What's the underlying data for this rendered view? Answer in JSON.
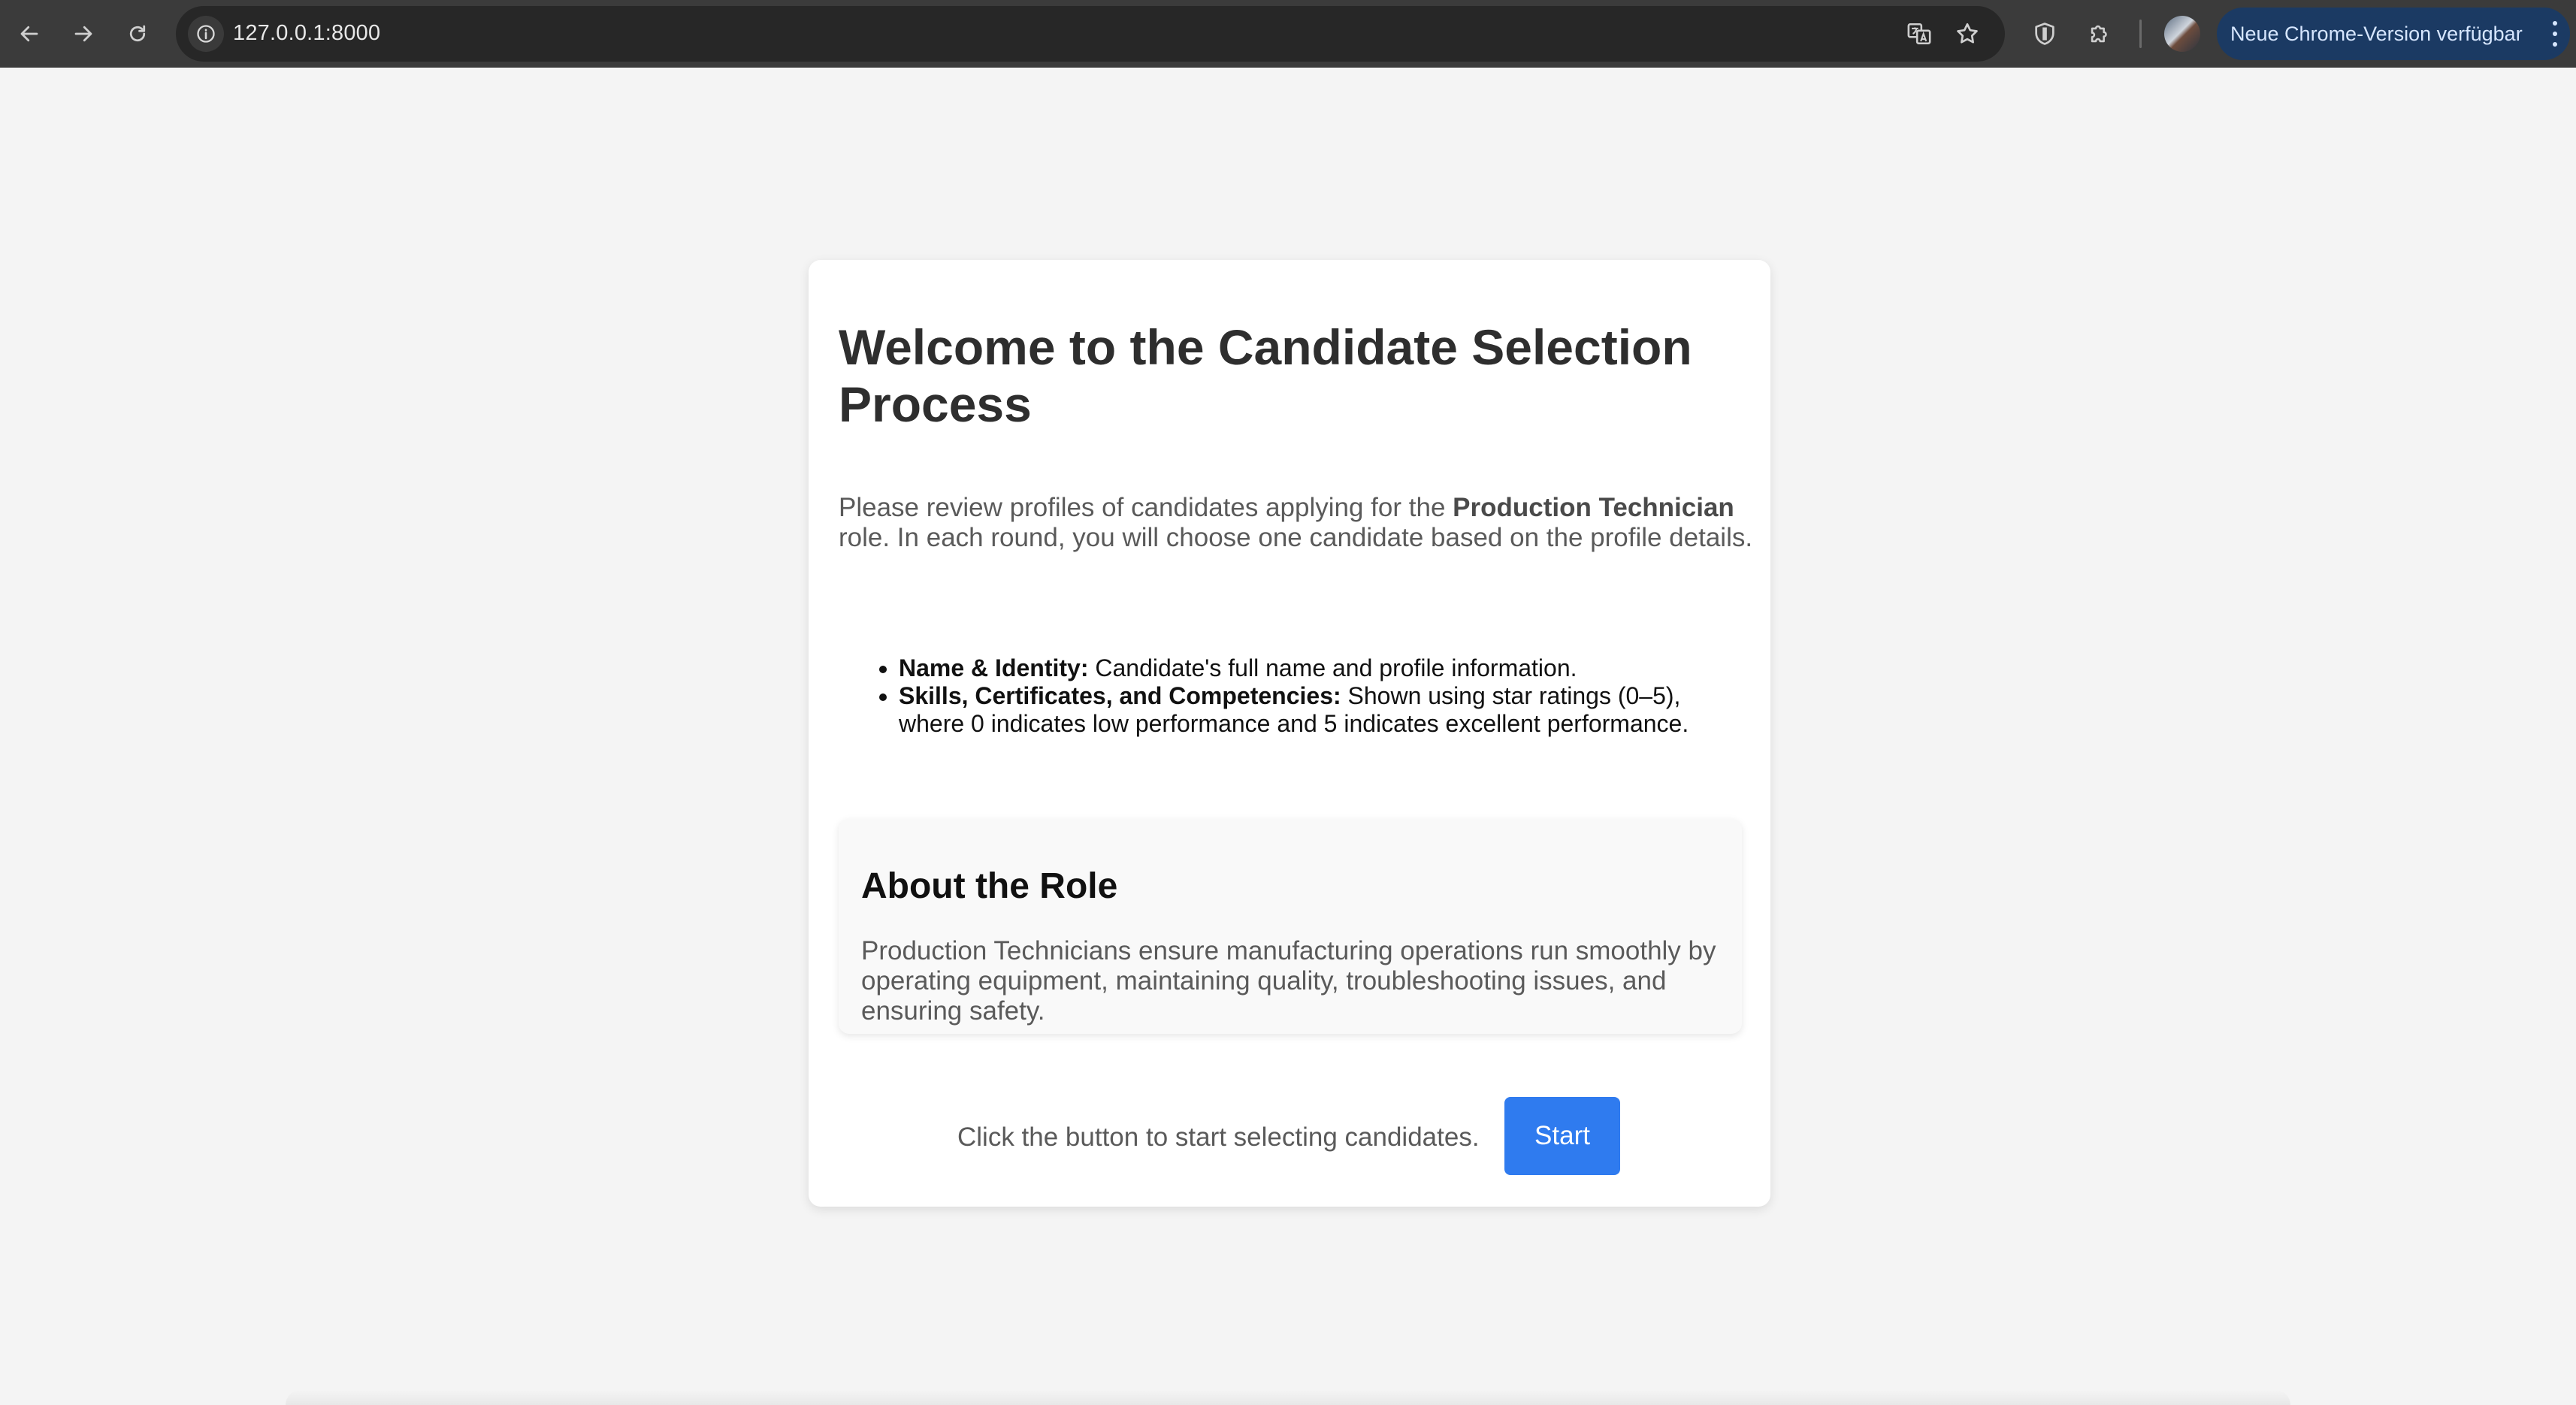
{
  "browser": {
    "url": "127.0.0.1:8000",
    "update_label": "Neue Chrome-Version verfügbar",
    "icons": [
      "back-arrow-icon",
      "forward-arrow-icon",
      "reload-icon",
      "site-info-icon",
      "translate-icon",
      "bookmark-star-icon",
      "shield-extension-icon",
      "puzzle-extensions-icon",
      "profile-avatar",
      "kebab-menu-icon"
    ]
  },
  "page": {
    "title": "Welcome to the Candidate Selection Process",
    "intro_prefix": "Please review profiles of candidates applying for the ",
    "intro_role": "Production Technician",
    "intro_suffix": " role. In each round, you will choose one candidate based on the profile details.",
    "features": [
      {
        "label": "Name & Identity:",
        "text": " Candidate's full name and profile information."
      },
      {
        "label": "Skills, Certificates, and Competencies:",
        "text": " Shown using star ratings (0–5), where 0 indicates low performance and 5 indicates excellent performance."
      }
    ],
    "about": {
      "title": "About the Role",
      "text": "Production Technicians ensure manufacturing operations run smoothly by operating equipment, maintaining quality, troubleshooting issues, and ensuring safety."
    },
    "start_prompt": "Click the button to start selecting candidates.",
    "start_label": "Start"
  },
  "colors": {
    "page_bg": "#f4f4f4",
    "card_bg": "#ffffff",
    "accent_button": "#2f7bef",
    "chrome_toolbar": "#3b3b3b",
    "update_chip": "#1b3a63"
  }
}
